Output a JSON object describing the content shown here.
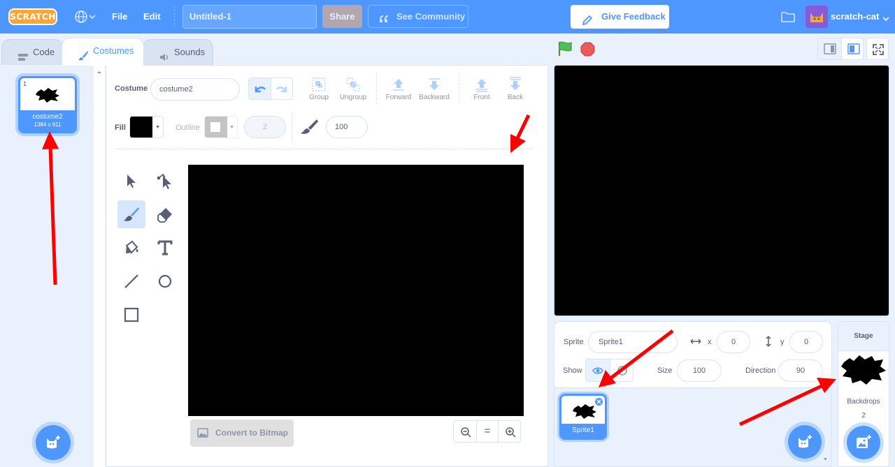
{
  "menubar": {
    "logo": "SCRATCH",
    "file": "File",
    "edit": "Edit",
    "project_title": "Untitled-1",
    "share": "Share",
    "see_community": "See Community",
    "give_feedback": "Give Feedback",
    "username": "scratch-cat"
  },
  "tabs": {
    "code": "Code",
    "costumes": "Costumes",
    "sounds": "Sounds"
  },
  "costumes": [
    {
      "number": "1",
      "name": "costume2",
      "size": "1384 x 911"
    }
  ],
  "paint_editor": {
    "costume_label": "Costume",
    "costume_name": "costume2",
    "toolbar": {
      "group": "Group",
      "ungroup": "Ungroup",
      "forward": "Forward",
      "backward": "Backward",
      "front": "Front",
      "back": "Back"
    },
    "fill_label": "Fill",
    "fill_color": "#000000",
    "outline_label": "Outline",
    "outline_width": "2",
    "brush_size": "100",
    "convert_button": "Convert to Bitmap",
    "zoom_reset": "="
  },
  "sprite_info": {
    "sprite_label": "Sprite",
    "sprite_name": "Sprite1",
    "x_label": "x",
    "x_value": "0",
    "y_label": "y",
    "y_value": "0",
    "show_label": "Show",
    "size_label": "Size",
    "size_value": "100",
    "direction_label": "Direction",
    "direction_value": "90"
  },
  "sprites": [
    {
      "name": "Sprite1"
    }
  ],
  "stage_selector": {
    "title": "Stage",
    "backdrops_label": "Backdrops",
    "backdrops_count": "2"
  },
  "colors": {
    "accent": "#4d97ff",
    "annotation_arrow": "#ff0000",
    "stop": "#ec5959",
    "flag": "#4cbf56"
  }
}
